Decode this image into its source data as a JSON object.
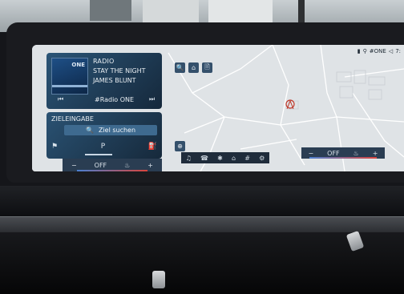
{
  "radio": {
    "source": "RADIO",
    "song": "STAY THE NIGHT",
    "artist": "JAMES BLUNT",
    "station": "#Radio ONE",
    "album_text": "ONE",
    "prev_icon": "⏮",
    "next_icon": "⏭"
  },
  "destination": {
    "title": "ZIELEINGABE",
    "search_label": "Ziel suchen",
    "search_icon": "🔍",
    "icons": [
      "⚑",
      "P",
      "⛽"
    ]
  },
  "status_bar": {
    "station": "#ONE",
    "time": "7:"
  },
  "map_buttons": [
    "🔍",
    "⌂",
    "🗎"
  ],
  "climate_left": {
    "off_label": "OFF",
    "minus": "−",
    "plus": "+"
  },
  "climate_right": {
    "off_label": "OFF",
    "minus": "−",
    "plus": "+"
  },
  "nav_bar": [
    "♫",
    "☎",
    "✱",
    "⌂",
    "#",
    "⚙"
  ],
  "colors": {
    "panel": "#2b5577",
    "map_bg": "#dfe3e6",
    "accent_red": "#d9453d"
  }
}
